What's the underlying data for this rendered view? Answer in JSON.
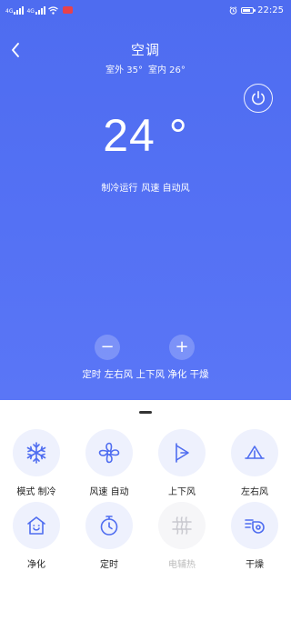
{
  "status_bar": {
    "signal_tag_1": "4G",
    "signal_tag_2": "4G",
    "time": "22:25"
  },
  "header": {
    "title": "空调",
    "outdoor_label": "室外 35°",
    "indoor_label": "室内 26°"
  },
  "thermostat": {
    "temperature": "24 °",
    "mode": "制冷运行",
    "fan_speed": "风速 自动风"
  },
  "controls": {
    "minus": "−",
    "plus": "+",
    "active_functions": "定时 左右风 上下风 净化 干燥"
  },
  "functions": [
    {
      "icon": "snowflake-icon",
      "label": "模式 制冷",
      "enabled": true
    },
    {
      "icon": "fan-icon",
      "label": "风速 自动",
      "enabled": true
    },
    {
      "icon": "vertical-swing-icon",
      "label": "上下风",
      "enabled": true
    },
    {
      "icon": "horizontal-swing-icon",
      "label": "左右风",
      "enabled": true
    },
    {
      "icon": "purify-icon",
      "label": "净化",
      "enabled": true
    },
    {
      "icon": "timer-icon",
      "label": "定时",
      "enabled": true
    },
    {
      "icon": "electric-heat-icon",
      "label": "电辅热",
      "enabled": false
    },
    {
      "icon": "dry-icon",
      "label": "干燥",
      "enabled": true
    }
  ],
  "colors": {
    "accent": "#5471f4",
    "icon_bg": "#eef1fd",
    "icon_stroke": "#4f6df0",
    "disabled": "#bbbbbb"
  }
}
